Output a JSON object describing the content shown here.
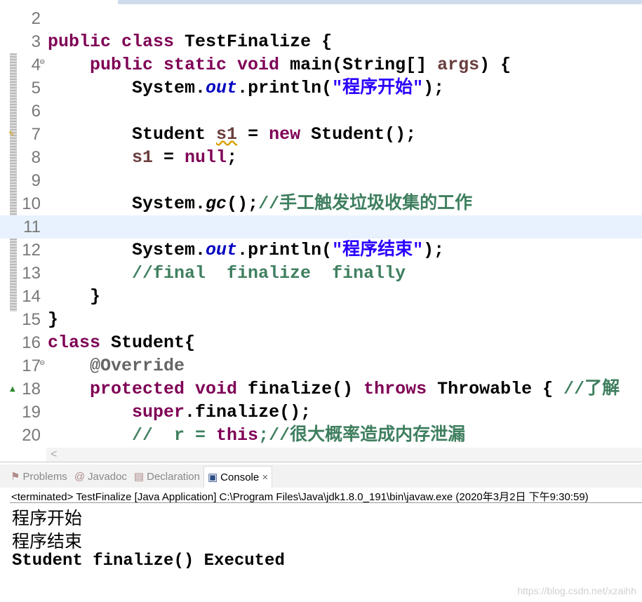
{
  "editor": {
    "lines": [
      {
        "n": "2",
        "t": []
      },
      {
        "n": "3",
        "t": [
          [
            "public class ",
            "kw"
          ],
          [
            "TestFinalize {",
            "pl"
          ]
        ]
      },
      {
        "n": "4",
        "t": [
          [
            "    public static void ",
            "kw"
          ],
          [
            "main(String[] ",
            "pl"
          ],
          [
            "args",
            "var"
          ],
          [
            ") {",
            "pl"
          ]
        ],
        "fold": "⊖"
      },
      {
        "n": "5",
        "t": [
          [
            "        System.",
            "pl"
          ],
          [
            "out",
            "fld"
          ],
          [
            ".println(",
            "pl"
          ],
          [
            "\"程序开始\"",
            "str"
          ],
          [
            ");",
            "pl"
          ]
        ]
      },
      {
        "n": "6",
        "t": []
      },
      {
        "n": "7",
        "t": [
          [
            "        Student ",
            "pl"
          ],
          [
            "s1",
            "var"
          ],
          [
            " = ",
            "pl"
          ],
          [
            "new ",
            "kw"
          ],
          [
            "Student();",
            "pl"
          ]
        ],
        "warn": true
      },
      {
        "n": "8",
        "t": [
          [
            "        s1",
            "var"
          ],
          [
            " = ",
            "pl"
          ],
          [
            "null",
            "kw"
          ],
          [
            ";",
            "pl"
          ]
        ]
      },
      {
        "n": "9",
        "t": []
      },
      {
        "n": "10",
        "t": [
          [
            "        System.",
            "pl"
          ],
          [
            "gc",
            "mth"
          ],
          [
            "();",
            "pl"
          ],
          [
            "//手工触发垃圾收集的工作",
            "cm"
          ]
        ]
      },
      {
        "n": "11",
        "t": [],
        "highlight": true
      },
      {
        "n": "12",
        "t": [
          [
            "        System.",
            "pl"
          ],
          [
            "out",
            "fld"
          ],
          [
            ".println(",
            "pl"
          ],
          [
            "\"程序结束\"",
            "str"
          ],
          [
            ");",
            "pl"
          ]
        ]
      },
      {
        "n": "13",
        "t": [
          [
            "        //final  finalize  finally",
            "cm"
          ]
        ]
      },
      {
        "n": "14",
        "t": [
          [
            "    }",
            "pl"
          ]
        ]
      },
      {
        "n": "15",
        "t": [
          [
            "}",
            "pl"
          ]
        ]
      },
      {
        "n": "16",
        "t": [
          [
            "class ",
            "kw"
          ],
          [
            "Student{",
            "pl"
          ]
        ]
      },
      {
        "n": "17",
        "t": [
          [
            "    @Override",
            "ann"
          ]
        ],
        "fold": "⊖"
      },
      {
        "n": "18",
        "t": [
          [
            "    protected void ",
            "kw"
          ],
          [
            "finalize() ",
            "pl"
          ],
          [
            "throws ",
            "kw"
          ],
          [
            "Throwable { ",
            "pl"
          ],
          [
            "//了解",
            "cm"
          ]
        ],
        "override": "▲"
      },
      {
        "n": "19",
        "t": [
          [
            "        super",
            "kw"
          ],
          [
            ".finalize();",
            "pl"
          ]
        ]
      },
      {
        "n": "20",
        "t": [
          [
            "        //  r = ",
            "cm"
          ],
          [
            "this",
            "kw"
          ],
          [
            ";//很大概率造成内存泄漏",
            "cm"
          ]
        ]
      }
    ],
    "hscroll_left": "<"
  },
  "tabs": [
    {
      "label": "Problems",
      "icon": "problems-icon"
    },
    {
      "label": "Javadoc",
      "icon": "at-icon"
    },
    {
      "label": "Declaration",
      "icon": "declaration-icon"
    },
    {
      "label": "Console",
      "icon": "console-icon",
      "active": true,
      "close": "✕"
    }
  ],
  "console": {
    "info": "<terminated> TestFinalize [Java Application] C:\\Program Files\\Java\\jdk1.8.0_191\\bin\\javaw.exe (2020年3月2日 下午9:30:59)",
    "output": [
      "程序开始",
      "程序结束",
      "Student finalize() Executed"
    ]
  },
  "watermark": "https://blog.csdn.net/xzaihh"
}
